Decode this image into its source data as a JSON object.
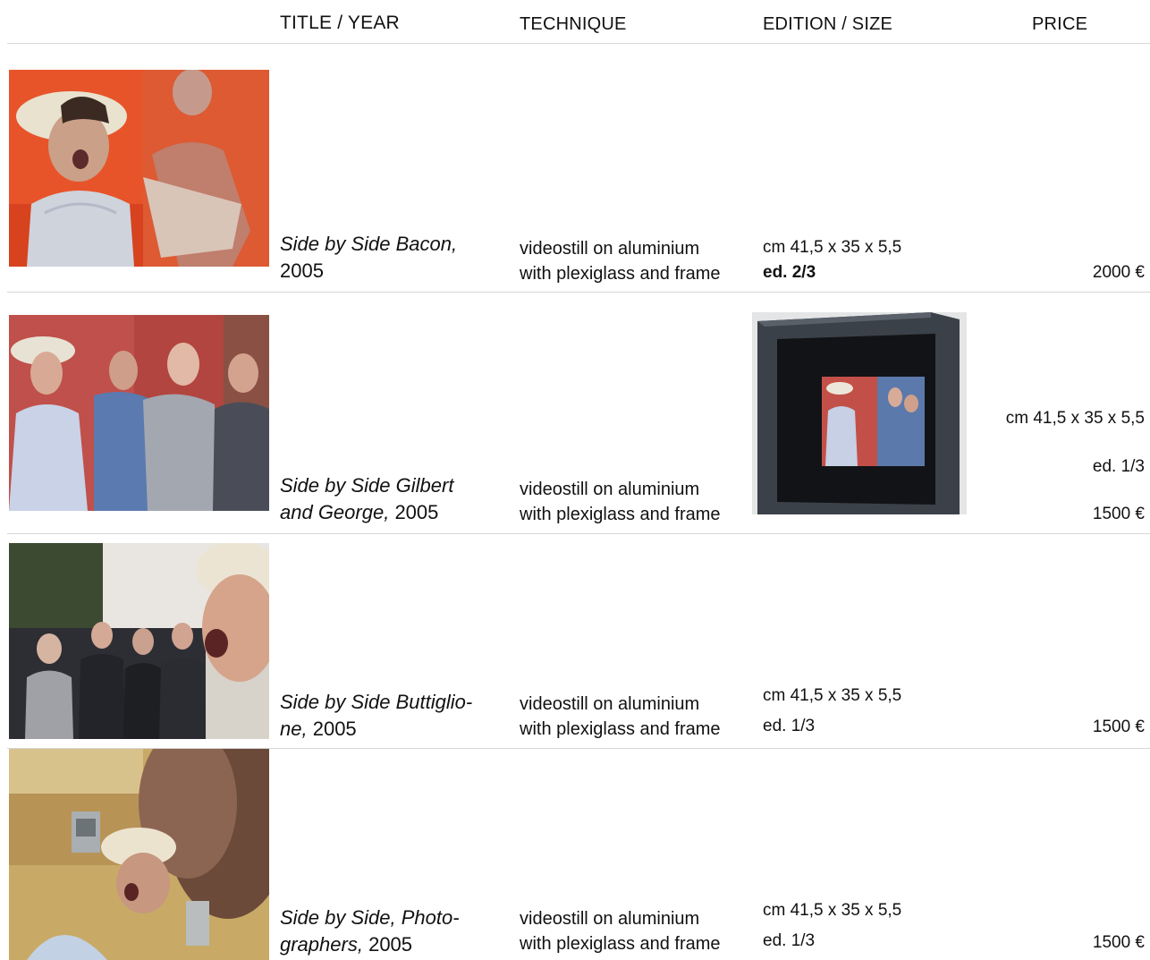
{
  "header": {
    "title_year": "TITLE / YEAR",
    "technique": "TECHNIQUE",
    "edition_size": "EDITION / SIZE",
    "price": "PRICE"
  },
  "works": [
    {
      "title": "Side by Side Bacon,",
      "year": "2005",
      "technique_line1": "videostill on aluminium",
      "technique_line2": "with plexiglass and frame",
      "size": "cm 41,5 x 35 x 5,5",
      "edition": "ed. 2/3",
      "price": "2000 €"
    },
    {
      "title_line1": "Side by Side Gilbert",
      "title_line2": "and George,",
      "year": "2005",
      "technique_line1": "videostill on aluminium",
      "technique_line2": "with plexiglass and frame",
      "size": "cm 41,5 x 35 x 5,5",
      "edition": "ed. 1/3",
      "price": "1500 €"
    },
    {
      "title_line1": "Side by Side Buttiglio-",
      "title_line2": "ne,",
      "year": "2005",
      "technique_line1": "videostill on aluminium",
      "technique_line2": "with plexiglass and frame",
      "size": "cm 41,5 x 35 x 5,5",
      "edition": "ed. 1/3",
      "price": "1500 €"
    },
    {
      "title_line1": "Side by Side, Photo-",
      "title_line2": "graphers,",
      "year": "2005",
      "technique_line1": "videostill on aluminium",
      "technique_line2": "with plexiglass and frame",
      "size": "cm 41,5 x 35 x 5,5",
      "edition": "ed. 1/3",
      "price": "1500 €"
    }
  ]
}
